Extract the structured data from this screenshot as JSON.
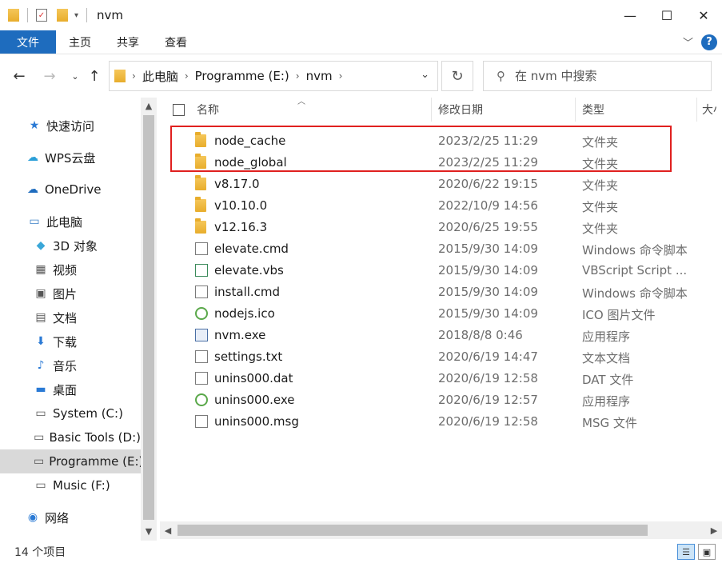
{
  "window": {
    "title": "nvm"
  },
  "ribbon": {
    "tabs": [
      "文件",
      "主页",
      "共享",
      "查看"
    ]
  },
  "address": {
    "crumbs": [
      "此电脑",
      "Programme (E:)",
      "nvm"
    ]
  },
  "search": {
    "placeholder": "在 nvm 中搜索"
  },
  "sidebar": {
    "items": [
      {
        "label": "快速访问",
        "icon": "star-icon"
      },
      {
        "label": "WPS云盘",
        "icon": "cloud-icon"
      },
      {
        "label": "OneDrive",
        "icon": "onedrive-icon"
      },
      {
        "label": "此电脑",
        "icon": "computer-icon"
      },
      {
        "label": "3D 对象",
        "icon": "cube-icon"
      },
      {
        "label": "视频",
        "icon": "video-icon"
      },
      {
        "label": "图片",
        "icon": "picture-icon"
      },
      {
        "label": "文档",
        "icon": "document-icon"
      },
      {
        "label": "下载",
        "icon": "download-icon"
      },
      {
        "label": "音乐",
        "icon": "music-icon"
      },
      {
        "label": "桌面",
        "icon": "desktop-icon"
      },
      {
        "label": "System (C:)",
        "icon": "system-drive-icon"
      },
      {
        "label": "Basic Tools (D:)",
        "icon": "drive-icon"
      },
      {
        "label": "Programme (E:)",
        "icon": "drive-icon",
        "selected": true
      },
      {
        "label": "Music (F:)",
        "icon": "drive-icon"
      },
      {
        "label": "网络",
        "icon": "network-icon"
      }
    ]
  },
  "columns": {
    "name": "名称",
    "date": "修改日期",
    "type": "类型",
    "size": "大小"
  },
  "files": [
    {
      "name": "node_cache",
      "date": "2023/2/25 11:29",
      "type": "文件夹",
      "icon": "folder-icon"
    },
    {
      "name": "node_global",
      "date": "2023/2/25 11:29",
      "type": "文件夹",
      "icon": "folder-icon"
    },
    {
      "name": "v8.17.0",
      "date": "2020/6/22 19:15",
      "type": "文件夹",
      "icon": "folder-icon"
    },
    {
      "name": "v10.10.0",
      "date": "2022/10/9 14:56",
      "type": "文件夹",
      "icon": "folder-icon"
    },
    {
      "name": "v12.16.3",
      "date": "2020/6/25 19:55",
      "type": "文件夹",
      "icon": "folder-icon"
    },
    {
      "name": "elevate.cmd",
      "date": "2015/9/30 14:09",
      "type": "Windows 命令脚本",
      "icon": "cmd-file-icon"
    },
    {
      "name": "elevate.vbs",
      "date": "2015/9/30 14:09",
      "type": "VBScript Script ...",
      "icon": "vbs-file-icon"
    },
    {
      "name": "install.cmd",
      "date": "2015/9/30 14:09",
      "type": "Windows 命令脚本",
      "icon": "cmd-file-icon"
    },
    {
      "name": "nodejs.ico",
      "date": "2015/9/30 14:09",
      "type": "ICO 图片文件",
      "icon": "nodejs-icon"
    },
    {
      "name": "nvm.exe",
      "date": "2018/8/8 0:46",
      "type": "应用程序",
      "icon": "exe-file-icon"
    },
    {
      "name": "settings.txt",
      "date": "2020/6/19 14:47",
      "type": "文本文档",
      "icon": "text-file-icon"
    },
    {
      "name": "unins000.dat",
      "date": "2020/6/19 12:58",
      "type": "DAT 文件",
      "icon": "blank-file-icon"
    },
    {
      "name": "unins000.exe",
      "date": "2020/6/19 12:57",
      "type": "应用程序",
      "icon": "nodejs-icon"
    },
    {
      "name": "unins000.msg",
      "date": "2020/6/19 12:58",
      "type": "MSG 文件",
      "icon": "blank-file-icon"
    }
  ],
  "status": {
    "count": "14 个项目"
  },
  "colors": {
    "accent": "#1e6cbe",
    "highlight_border": "#e0201f"
  }
}
